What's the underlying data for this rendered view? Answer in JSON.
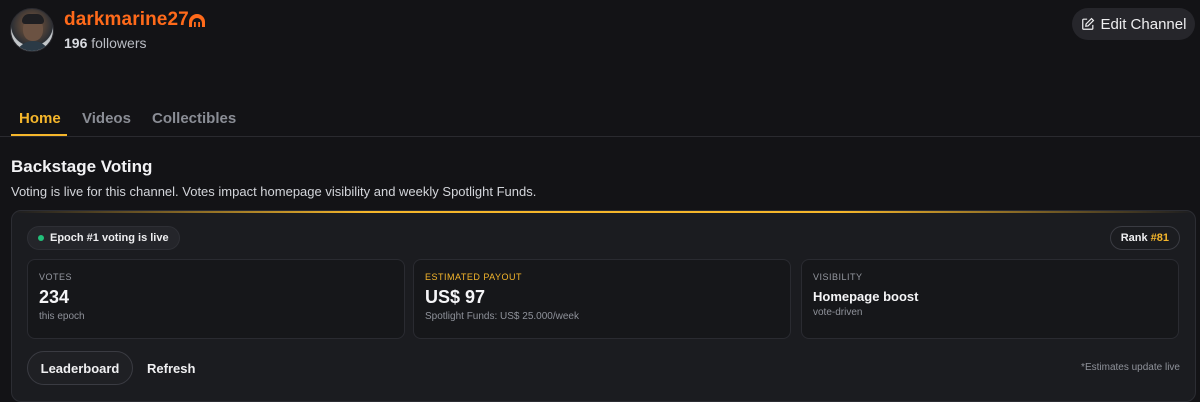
{
  "header": {
    "channel_name": "darkmarine27",
    "followers_count": "196",
    "followers_label": "followers",
    "edit_button_label": "Edit Channel",
    "badge_icon": "crown-icon",
    "edit_icon": "pencil-square-icon"
  },
  "tabs": [
    {
      "label": "Home",
      "active": true
    },
    {
      "label": "Videos",
      "active": false
    },
    {
      "label": "Collectibles",
      "active": false
    }
  ],
  "section": {
    "title": "Backstage Voting",
    "description": "Voting is live for this channel. Votes impact homepage visibility and weekly Spotlight Funds."
  },
  "voting_card": {
    "epoch_status": "Epoch #1 voting is live",
    "rank_label": "Rank",
    "rank_value": "#81",
    "stats": [
      {
        "label": "VOTES",
        "value": "234",
        "sub": "this epoch"
      },
      {
        "label": "ESTIMATED PAYOUT",
        "value": "US$ 97",
        "sub": "Spotlight Funds: US$ 25.000/week"
      },
      {
        "label": "VISIBILITY",
        "value": "Homepage boost",
        "sub": "vote-driven"
      }
    ],
    "leaderboard_button": "Leaderboard",
    "refresh_button": "Refresh",
    "footnote": "*Estimates update live"
  },
  "colors": {
    "background": "#131316",
    "accent": "#f5b62b",
    "channel_name": "#ff6a1a",
    "live_dot": "#22c07a"
  }
}
